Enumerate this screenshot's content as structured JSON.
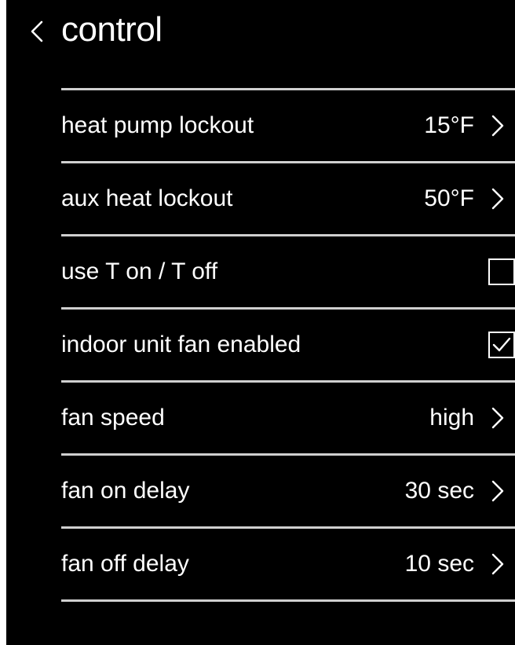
{
  "header": {
    "title": "control",
    "back_icon": "chevron-left-icon"
  },
  "settings": [
    {
      "label": "heat pump lockout",
      "value": "15°F",
      "type": "link",
      "icon": "chevron-right-icon"
    },
    {
      "label": "aux heat lockout",
      "value": "50°F",
      "type": "link",
      "icon": "chevron-right-icon"
    },
    {
      "label": "use T on / T off",
      "type": "checkbox",
      "checked": false
    },
    {
      "label": "indoor unit fan enabled",
      "type": "checkbox",
      "checked": true
    },
    {
      "label": "fan speed",
      "value": "high",
      "type": "link",
      "icon": "chevron-right-icon"
    },
    {
      "label": "fan on delay",
      "value": "30 sec",
      "type": "link",
      "icon": "chevron-right-icon"
    },
    {
      "label": "fan off delay",
      "value": "10 sec",
      "type": "link",
      "icon": "chevron-right-icon"
    }
  ],
  "colors": {
    "background": "#000000",
    "text": "#ffffff",
    "divider": "#cfcfcf"
  }
}
